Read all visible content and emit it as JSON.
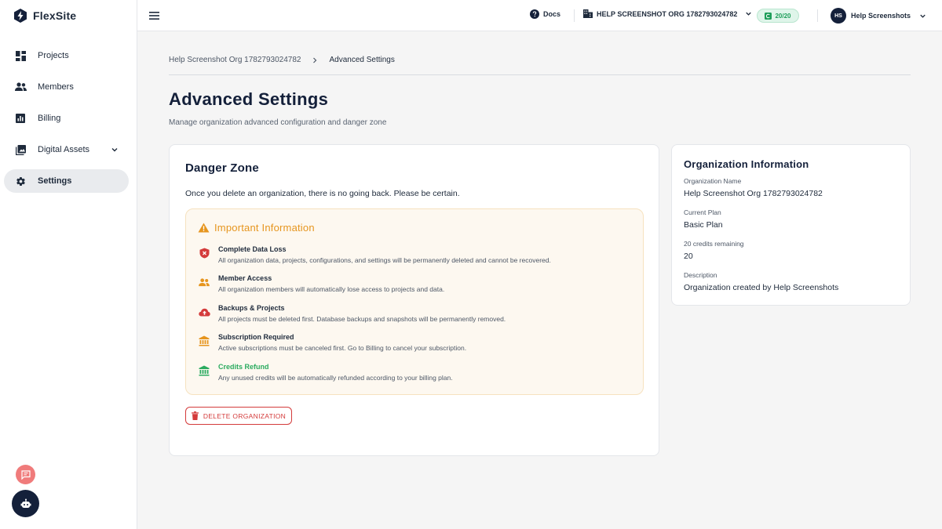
{
  "brand": {
    "name": "FlexSite"
  },
  "sidebar": {
    "items": [
      {
        "label": "Projects",
        "icon": "dashboard-icon"
      },
      {
        "label": "Members",
        "icon": "people-icon"
      },
      {
        "label": "Billing",
        "icon": "bar-chart-icon"
      },
      {
        "label": "Digital Assets",
        "icon": "image-icon"
      },
      {
        "label": "Settings",
        "icon": "gear-icon",
        "active": true
      }
    ]
  },
  "topbar": {
    "docs_label": "Docs",
    "org_label": "HELP SCREENSHOT ORG 1782793024782",
    "credits_label": "20/20",
    "user_initials": "HS",
    "user_name": "Help Screenshots"
  },
  "breadcrumb": {
    "parent": "Help Screenshot Org 1782793024782",
    "current": "Advanced Settings"
  },
  "page": {
    "title": "Advanced Settings",
    "subtitle": "Manage organization advanced configuration and danger zone"
  },
  "danger_zone": {
    "title": "Danger Zone",
    "warning": "Once you delete an organization, there is no going back. Please be certain.",
    "info_heading": "Important Information",
    "items": [
      {
        "title": "Complete Data Loss",
        "desc": "All organization data, projects, configurations, and settings will be permanently deleted and cannot be recovered."
      },
      {
        "title": "Member Access",
        "desc": "All organization members will automatically lose access to projects and data."
      },
      {
        "title": "Backups & Projects",
        "desc": "All projects must be deleted first. Database backups and snapshots will be permanently removed."
      },
      {
        "title": "Subscription Required",
        "desc": "Active subscriptions must be canceled first. Go to Billing to cancel your subscription."
      },
      {
        "title": "Credits Refund",
        "desc": "Any unused credits will be automatically refunded according to your billing plan."
      }
    ],
    "delete_label": "DELETE ORGANIZATION"
  },
  "org_info": {
    "title": "Organization Information",
    "fields": [
      {
        "label": "Organization Name",
        "value": "Help Screenshot Org 1782793024782"
      },
      {
        "label": "Current Plan",
        "value": "Basic Plan"
      },
      {
        "label": "20 credits remaining",
        "value": "20"
      },
      {
        "label": "Description",
        "value": "Organization created by Help Screenshots"
      }
    ]
  },
  "colors": {
    "navy": "#14203a",
    "danger": "#d43b3b",
    "warning": "#e6951e",
    "success": "#2bab5f"
  }
}
